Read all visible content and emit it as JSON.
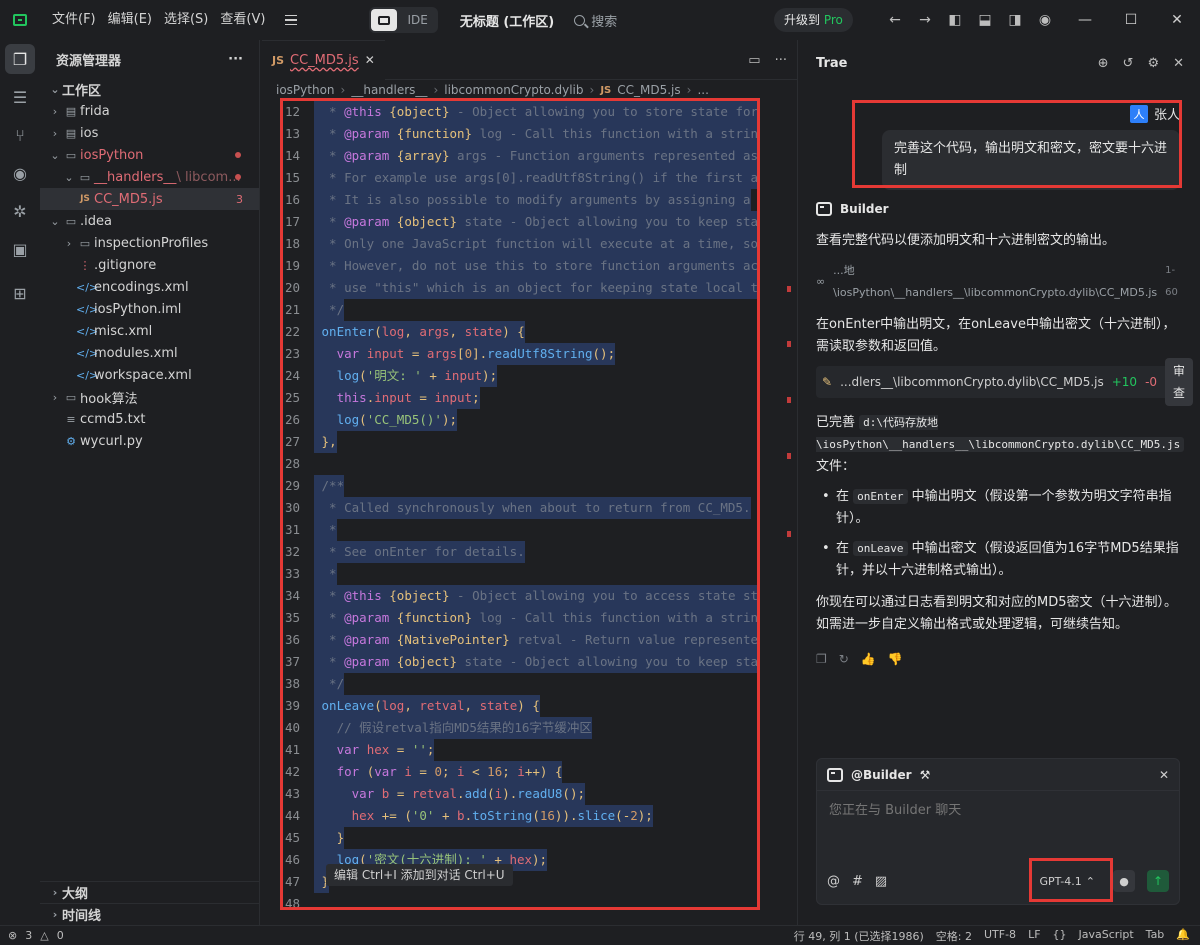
{
  "titlebar": {
    "menus": [
      "文件(F)",
      "编辑(E)",
      "选择(S)",
      "查看(V)"
    ],
    "ide_label": "IDE",
    "workspace_title": "无标题 (工作区)",
    "search_label": "搜索",
    "upgrade_label": "升级到",
    "upgrade_pro": "Pro"
  },
  "explorer": {
    "title": "资源管理器",
    "more": "···",
    "workspace": "工作区",
    "items": [
      {
        "label": "frida",
        "type": "folder"
      },
      {
        "label": "ios",
        "type": "folder"
      },
      {
        "label": "iosPython",
        "type": "folder-open"
      },
      {
        "label": "__handlers__",
        "dim": "\\ libcom...",
        "type": "folder-open"
      },
      {
        "label": "CC_MD5.js",
        "badge": "3",
        "type": "js"
      },
      {
        "label": ".idea",
        "type": "folder-open"
      },
      {
        "label": "inspectionProfiles",
        "type": "folder"
      },
      {
        "label": ".gitignore",
        "type": "file"
      },
      {
        "label": "encodings.xml",
        "type": "xml"
      },
      {
        "label": "iosPython.iml",
        "type": "xml"
      },
      {
        "label": "misc.xml",
        "type": "xml"
      },
      {
        "label": "modules.xml",
        "type": "xml"
      },
      {
        "label": "workspace.xml",
        "type": "xml"
      },
      {
        "label": "hook算法",
        "type": "folder"
      },
      {
        "label": "ccmd5.txt",
        "type": "txt"
      },
      {
        "label": "wycurl.py",
        "type": "py"
      }
    ],
    "outline": "大纲",
    "timeline": "时间线"
  },
  "editor": {
    "tab_label": "CC_MD5.js",
    "tab_prefix": "JS",
    "breadcrumb": [
      "iosPython",
      "__handlers__",
      "libcommonCrypto.dylib",
      "CC_MD5.js",
      "..."
    ],
    "inline_hint": "编辑 Ctrl+I  添加到对话 Ctrl+U",
    "lines": [
      {
        "n": "12",
        "t": "  * @this {object} - Object allowing you to store state for"
      },
      {
        "n": "13",
        "t": "  * @param {function} log - Call this function with a strin"
      },
      {
        "n": "14",
        "t": "  * @param {array} args - Function arguments represented as"
      },
      {
        "n": "15",
        "t": "  * For example use args[0].readUtf8String() if the first a"
      },
      {
        "n": "16",
        "t": "  * It is also possible to modify arguments by assigning a"
      },
      {
        "n": "17",
        "t": "  * @param {object} state - Object allowing you to keep sta"
      },
      {
        "n": "18",
        "t": "  * Only one JavaScript function will execute at a time, so"
      },
      {
        "n": "19",
        "t": "  * However, do not use this to store function arguments ac"
      },
      {
        "n": "20",
        "t": "  * use \"this\" which is an object for keeping state local t"
      },
      {
        "n": "21",
        "t": "  */"
      },
      {
        "n": "22",
        "t": " onEnter(log, args, state) {"
      },
      {
        "n": "23",
        "t": "   var input = args[0].readUtf8String();"
      },
      {
        "n": "24",
        "t": "   log('明文: ' + input);"
      },
      {
        "n": "25",
        "t": "   this.input = input;"
      },
      {
        "n": "26",
        "t": "   log('CC_MD5()');"
      },
      {
        "n": "27",
        "t": " },"
      },
      {
        "n": "28",
        "t": ""
      },
      {
        "n": "29",
        "t": " /**"
      },
      {
        "n": "30",
        "t": "  * Called synchronously when about to return from CC_MD5."
      },
      {
        "n": "31",
        "t": "  *"
      },
      {
        "n": "32",
        "t": "  * See onEnter for details."
      },
      {
        "n": "33",
        "t": "  *"
      },
      {
        "n": "34",
        "t": "  * @this {object} - Object allowing you to access state st"
      },
      {
        "n": "35",
        "t": "  * @param {function} log - Call this function with a strin"
      },
      {
        "n": "36",
        "t": "  * @param {NativePointer} retval - Return value represente"
      },
      {
        "n": "37",
        "t": "  * @param {object} state - Object allowing you to keep sta"
      },
      {
        "n": "38",
        "t": "  */"
      },
      {
        "n": "39",
        "t": " onLeave(log, retval, state) {"
      },
      {
        "n": "40",
        "t": "   // 假设retval指向MD5结果的16字节缓冲区"
      },
      {
        "n": "41",
        "t": "   var hex = '';"
      },
      {
        "n": "42",
        "t": "   for (var i = 0; i < 16; i++) {"
      },
      {
        "n": "43",
        "t": "     var b = retval.add(i).readU8();"
      },
      {
        "n": "44",
        "t": "     hex += ('0' + b.toString(16)).slice(-2);"
      },
      {
        "n": "45",
        "t": "   }"
      },
      {
        "n": "46",
        "t": "   log('密文(十六进制): ' + hex);"
      },
      {
        "n": "47",
        "t": " }"
      },
      {
        "n": "48",
        "t": ""
      }
    ]
  },
  "chat": {
    "title": "Trae",
    "user_name": "张人",
    "user_avatar": "人",
    "user_message": "完善这个代码，输出明文和密文，密文要十六进制",
    "bot_name": "Builder",
    "p1": "查看完整代码以便添加明文和十六进制密文的输出。",
    "file_ref": "...地\\iosPython\\__handlers__\\libcommonCrypto.dylib\\CC_MD5.js",
    "file_range": "1-60",
    "p2": "在onEnter中输出明文，在onLeave中输出密文（十六进制），需读取参数和返回值。",
    "edit_file": "...dlers__\\libcommonCrypto.dylib\\CC_MD5.js",
    "edit_plus": "+10",
    "edit_minus": "-0",
    "review": "审查",
    "done_prefix": "已完善",
    "done_path": "d:\\代码存放地\\iosPython\\__handlers__\\libcommonCrypto.dylib\\CC_MD5.js",
    "done_suffix": "文件：",
    "b1_pre": "在",
    "b1_code": "onEnter",
    "b1_post": "中输出明文（假设第一个参数为明文字符串指针）。",
    "b2_pre": "在",
    "b2_code": "onLeave",
    "b2_post": "中输出密文（假设返回值为16字节MD5结果指针，并以十六进制格式输出）。",
    "p3": "你现在可以通过日志看到明文和对应的MD5密文（十六进制）。如需进一步自定义输出格式或处理逻辑，可继续告知。",
    "composer_agent": "@Builder",
    "composer_placeholder": "您正在与 Builder 聊天",
    "model": "GPT-4.1"
  },
  "statusbar": {
    "errors": "3",
    "warnings": "0",
    "position": "行 49, 列 1 (已选择1986)",
    "spaces": "空格: 2",
    "encoding": "UTF-8",
    "eol": "LF",
    "braces": "{}",
    "language": "JavaScript",
    "tab": "Tab"
  }
}
